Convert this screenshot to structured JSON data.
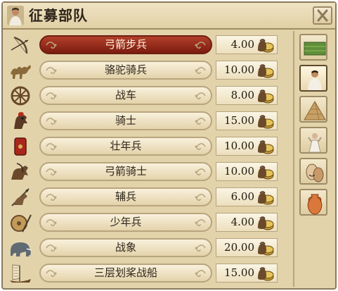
{
  "window": {
    "title": "征募部队",
    "close_icon": "close-icon"
  },
  "units": [
    {
      "name": "弓箭步兵",
      "cost": "4.00",
      "icon": "bow-icon",
      "selected": true
    },
    {
      "name": "骆驼骑兵",
      "cost": "10.00",
      "icon": "camel-icon"
    },
    {
      "name": "战车",
      "cost": "8.00",
      "icon": "chariot-wheel-icon"
    },
    {
      "name": "骑士",
      "cost": "15.00",
      "icon": "knight-icon"
    },
    {
      "name": "壮年兵",
      "cost": "10.00",
      "icon": "shield-icon"
    },
    {
      "name": "弓箭骑士",
      "cost": "10.00",
      "icon": "horse-archer-icon"
    },
    {
      "name": "辅兵",
      "cost": "6.00",
      "icon": "auxiliary-icon"
    },
    {
      "name": "少年兵",
      "cost": "4.00",
      "icon": "round-shield-icon"
    },
    {
      "name": "战象",
      "cost": "20.00",
      "icon": "elephant-icon"
    },
    {
      "name": "三层划桨战船",
      "cost": "15.00",
      "icon": "ship-icon"
    }
  ],
  "side_tabs": [
    "field-icon",
    "citizen-icon",
    "pyramid-icon",
    "priest-icon",
    "masks-icon",
    "amphora-icon"
  ],
  "colors": {
    "selected": "#9a2e1c",
    "panel": "#e3d3ab"
  }
}
